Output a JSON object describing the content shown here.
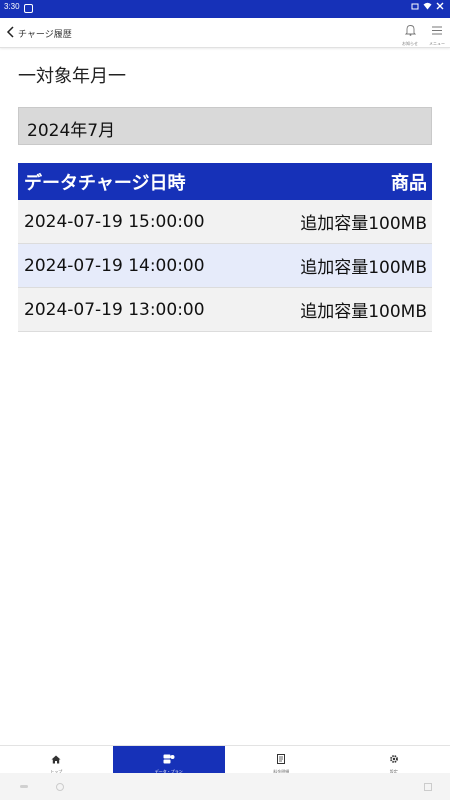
{
  "status_bar": {
    "time": "3:30"
  },
  "header": {
    "title": "チャージ履歴",
    "notice_label": "お知らせ",
    "menu_label": "メニュー"
  },
  "section": {
    "title": "一対象年月一"
  },
  "month": {
    "value": "2024年7月"
  },
  "table": {
    "headers": {
      "datetime": "データチャージ日時",
      "product": "商品"
    },
    "rows": [
      {
        "datetime": "2024-07-19 15:00:00",
        "product": "追加容量100MB"
      },
      {
        "datetime": "2024-07-19 14:00:00",
        "product": "追加容量100MB"
      },
      {
        "datetime": "2024-07-19 13:00:00",
        "product": "追加容量100MB"
      }
    ]
  },
  "bottom_nav": {
    "tabs": [
      {
        "label_line1": "トップ",
        "label_line2": "(データ残量)",
        "icon": "home-icon",
        "active": false
      },
      {
        "label_line1": "データ・プラン",
        "label_line2": "",
        "icon": "data-plan-icon",
        "active": true
      },
      {
        "label_line1": "料金明細",
        "label_line2": "",
        "icon": "bill-icon",
        "active": false
      },
      {
        "label_line1": "設定",
        "label_line2": "",
        "icon": "gear-icon",
        "active": false
      }
    ]
  },
  "colors": {
    "accent": "#1631b8",
    "row_alt": "#e6ebfa",
    "row_base": "#f2f2f2",
    "month_box": "#d9d9d9"
  }
}
